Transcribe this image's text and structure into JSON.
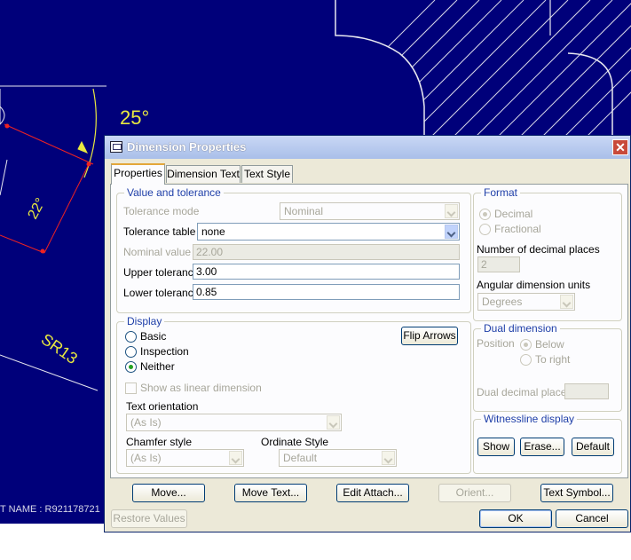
{
  "cad": {
    "angle_25": "25°",
    "dim_22": "22°",
    "radius_label": "SR13",
    "status_text": "T    NAME : R921178721"
  },
  "dialog": {
    "title": "Dimension Properties",
    "close_glyph": "✕",
    "tabs": [
      "Properties",
      "Dimension Text",
      "Text Style"
    ],
    "active_tab": "Properties",
    "value_tolerance": {
      "title": "Value and tolerance",
      "tolerance_mode_label": "Tolerance mode",
      "tolerance_mode_value": "Nominal",
      "tolerance_table_label": "Tolerance table",
      "tolerance_table_value": "none",
      "nominal_value_label": "Nominal value",
      "nominal_value": "22.00",
      "upper_tolerance_label": "Upper tolerance",
      "upper_tolerance": "3.00",
      "lower_tolerance_label": "Lower tolerance",
      "lower_tolerance": "0.85"
    },
    "format": {
      "title": "Format",
      "decimal_label": "Decimal",
      "fractional_label": "Fractional",
      "selected": "Decimal",
      "decimal_places_label": "Number of decimal places",
      "decimal_places": "2",
      "angular_units_label": "Angular dimension units",
      "angular_units_value": "Degrees"
    },
    "display": {
      "title": "Display",
      "basic_label": "Basic",
      "inspection_label": "Inspection",
      "neither_label": "Neither",
      "selected": "Neither",
      "flip_arrows_label": "Flip Arrows",
      "show_linear_label": "Show as linear dimension",
      "text_orientation_label": "Text orientation",
      "text_orientation_value": "(As Is)",
      "chamfer_style_label": "Chamfer style",
      "chamfer_style_value": "(As Is)",
      "ordinate_style_label": "Ordinate Style",
      "ordinate_style_value": "Default"
    },
    "dual_dimension": {
      "title": "Dual dimension",
      "position_label": "Position",
      "below_label": "Below",
      "to_right_label": "To right",
      "selected": "Below",
      "dual_decimal_places_label": "Dual decimal places",
      "dual_decimal_places": ""
    },
    "witnessline": {
      "title": "Witnessline display",
      "show_label": "Show",
      "erase_label": "Erase...",
      "default_label": "Default"
    },
    "actions": {
      "move_label": "Move...",
      "move_text_label": "Move Text...",
      "edit_attach_label": "Edit Attach...",
      "orient_label": "Orient...",
      "text_symbol_label": "Text Symbol..."
    },
    "footer": {
      "restore_values_label": "Restore Values",
      "ok_label": "OK",
      "cancel_label": "Cancel"
    }
  },
  "colors": {
    "cad_background": "#00007a",
    "cad_lines": "#e8e8f0",
    "cad_dimension": "#ee2222",
    "cad_text": "#e8e840",
    "dialog_face": "#ece9d8",
    "group_title": "#1f3fa8"
  }
}
